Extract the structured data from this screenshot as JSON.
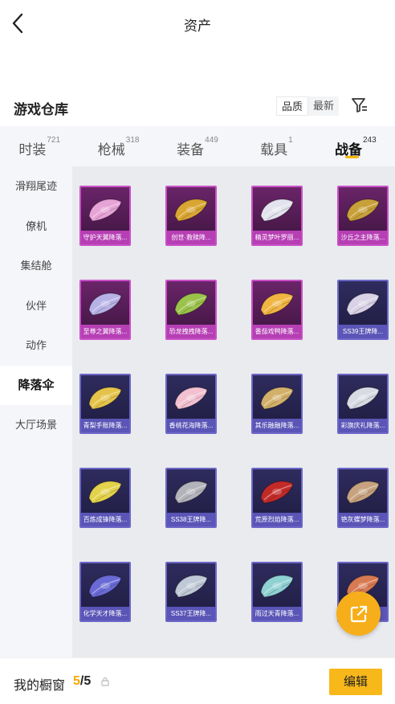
{
  "header": {
    "title": "资产"
  },
  "warehouse": {
    "title": "游戏仓库",
    "sort_options": [
      "品质",
      "最新"
    ],
    "active_sort": "品质"
  },
  "tabs": [
    {
      "label": "时装",
      "count": "721"
    },
    {
      "label": "枪械",
      "count": "318"
    },
    {
      "label": "装备",
      "count": "449"
    },
    {
      "label": "载具",
      "count": "1"
    },
    {
      "label": "战备",
      "count": "243",
      "active": true
    }
  ],
  "sidebar": {
    "items": [
      "滑翔尾迹",
      "僚机",
      "集结舱",
      "伙伴",
      "动作",
      "降落伞",
      "大厅场景"
    ],
    "active": "降落伞"
  },
  "items": [
    {
      "name": "守护天翼降落...",
      "rarity": "purple",
      "color": "#e6a3d6"
    },
    {
      "name": "创世·救赎降...",
      "rarity": "purple",
      "color": "#d8a632"
    },
    {
      "name": "精灵梦叶罗丽...",
      "rarity": "purple",
      "color": "#e3e3ee"
    },
    {
      "name": "沙丘之主降落...",
      "rarity": "purple",
      "color": "#c8a03a"
    },
    {
      "name": "至尊之翼降落...",
      "rarity": "purple",
      "color": "#b7b2e6"
    },
    {
      "name": "恐龙拽拽降落...",
      "rarity": "purple",
      "color": "#9bc24a"
    },
    {
      "name": "番茄戏鸭降落...",
      "rarity": "purple",
      "color": "#f1b541"
    },
    {
      "name": "SS39王牌降...",
      "rarity": "navy",
      "color": "#d9d2e6"
    },
    {
      "name": "青梨手账降落...",
      "rarity": "navy",
      "color": "#e5c34a"
    },
    {
      "name": "香桃花海降落...",
      "rarity": "navy",
      "color": "#f2c0d0"
    },
    {
      "name": "其乐融融降落...",
      "rarity": "navy",
      "color": "#d2b06a"
    },
    {
      "name": "彩旗庆礼降落...",
      "rarity": "navy",
      "color": "#d9dbe3"
    },
    {
      "name": "百炼成锋降落...",
      "rarity": "navy",
      "color": "#e3d24a"
    },
    {
      "name": "SS38王牌降...",
      "rarity": "navy",
      "color": "#b3b3bb"
    },
    {
      "name": "荒原烈焰降落...",
      "rarity": "navy",
      "color": "#c22a28"
    },
    {
      "name": "铯灰蝶梦降落...",
      "rarity": "navy",
      "color": "#c6a27e"
    },
    {
      "name": "化学天才降落...",
      "rarity": "navy",
      "color": "#6a6ad6"
    },
    {
      "name": "SS37王牌降...",
      "rarity": "navy",
      "color": "#bfc8d6"
    },
    {
      "name": "雨过天青降落...",
      "rarity": "navy",
      "color": "#8fd0d3"
    },
    {
      "name": "",
      "rarity": "navy",
      "color": "#d87a52"
    }
  ],
  "showcase": {
    "label": "我的橱窗",
    "current": "5",
    "separator": "/",
    "total": "5"
  },
  "edit_button": "编辑",
  "colors": {
    "accent": "#f5b800",
    "fab": "#f6ae1a",
    "purple_border": "#c94fc7",
    "navy_border": "#6c67c8"
  }
}
